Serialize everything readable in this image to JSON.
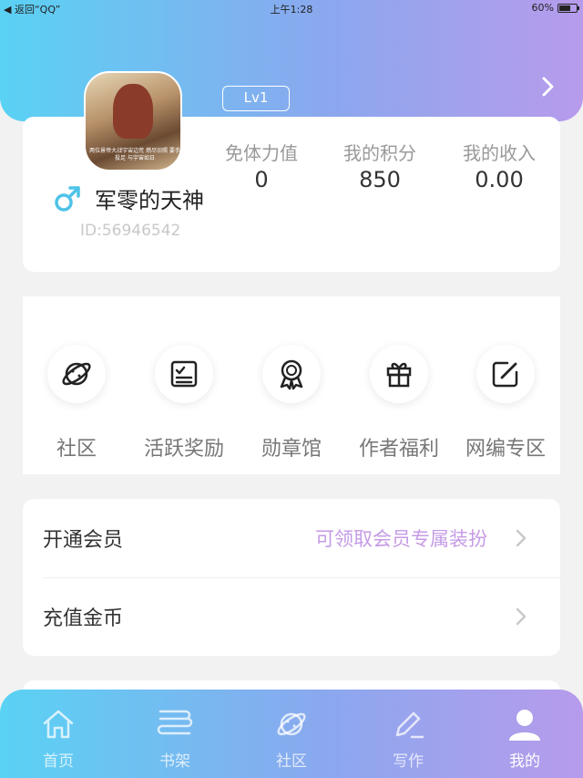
{
  "status_bar": {
    "back_label": "返回“QQ”",
    "time": "上午1:28",
    "battery": "60%"
  },
  "profile": {
    "level": "Lv1",
    "username": "军零的天神",
    "user_id": "ID:56946542",
    "avatar_caption": "两位景帝大战宇宙边荒 燃尽旧照 要手投足 与宇宙如日",
    "stats": [
      {
        "label": "免体力值",
        "value": "0"
      },
      {
        "label": "我的积分",
        "value": "850"
      },
      {
        "label": "我的收入",
        "value": "0.00"
      }
    ]
  },
  "features": [
    {
      "label": "社区",
      "icon": "planet-icon"
    },
    {
      "label": "活跃奖励",
      "icon": "checklist-icon"
    },
    {
      "label": "勋章馆",
      "icon": "medal-icon"
    },
    {
      "label": "作者福利",
      "icon": "gift-icon"
    },
    {
      "label": "网编专区",
      "icon": "edit-icon"
    }
  ],
  "menu": [
    {
      "label": "开通会员",
      "hint": "可领取会员专属装扮"
    },
    {
      "label": "充值金币",
      "hint": ""
    }
  ],
  "tabs": [
    {
      "label": "首页",
      "icon": "home-icon",
      "active": false
    },
    {
      "label": "书架",
      "icon": "bookshelf-icon",
      "active": false
    },
    {
      "label": "社区",
      "icon": "planet-icon",
      "active": false
    },
    {
      "label": "写作",
      "icon": "pen-icon",
      "active": false
    },
    {
      "label": "我的",
      "icon": "user-icon",
      "active": true
    }
  ],
  "colors": {
    "gradient_start": "#5ad2f4",
    "gradient_end": "#b79bec",
    "hint": "#c59be6",
    "gender": "#4fc3e8"
  }
}
